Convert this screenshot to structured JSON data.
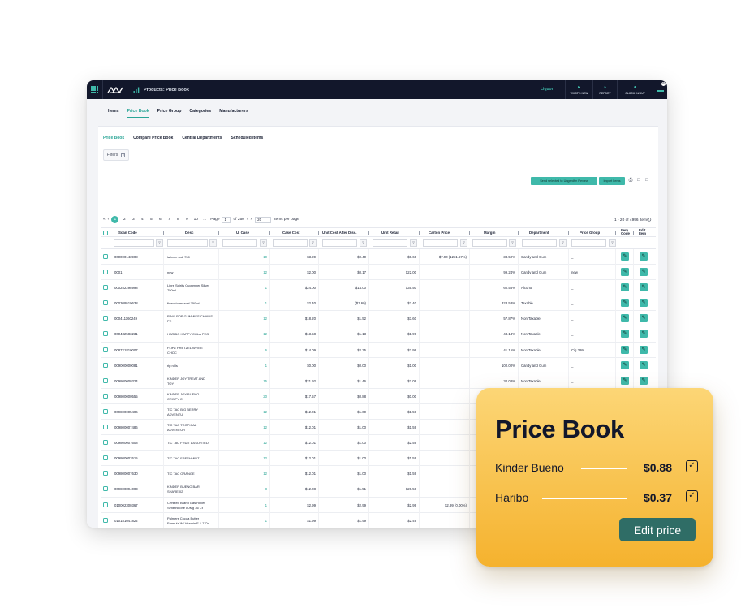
{
  "topbar": {
    "title": "Products: Price Book",
    "user": "Liquor",
    "actions": [
      {
        "label": "WHAT'S NEW",
        "icon": "megaphone-icon"
      },
      {
        "label": "REPORT",
        "icon": "report-chart-icon"
      },
      {
        "label": "CLOCK IN/OUT",
        "icon": "clock-icon"
      }
    ],
    "notification_count": "0"
  },
  "main_tabs": [
    "Items",
    "Price Book",
    "Price Group",
    "Categories",
    "Manufacturers"
  ],
  "active_main_tab": "Price Book",
  "sub_tabs": [
    "Price Book",
    "Compare Price Book",
    "Central Departments",
    "Scheduled Items"
  ],
  "filters_label": "Filters",
  "actions": {
    "send_selected": "Send selected to Ungerdfm Review",
    "import": "Import Items"
  },
  "pager": {
    "pages": [
      "1",
      "2",
      "3",
      "4",
      "5",
      "6",
      "7",
      "8",
      "9",
      "10",
      "..."
    ],
    "page_label": "Page",
    "page_value": "1",
    "of_label": "of 250",
    "per_page_value": "20",
    "per_page_label": "items per page",
    "count": "1 - 20 of 4996 items"
  },
  "columns": [
    "Scan Code",
    "Desc",
    "U. Case",
    "Case Cost",
    "Unit Cost After Disc.",
    "Unit Retail",
    "Carton Price",
    "Margin",
    "Department",
    "Price Group",
    "Item Code",
    "Edit Item"
  ],
  "rows": [
    {
      "scan": "000000143908",
      "desc": [
        "la terre cab 750"
      ],
      "ucase": "10",
      "case_cost": "$3.99",
      "unit_cost": "$0.40",
      "retail": "$0.60",
      "carton": "$7.90 (1231.67%)",
      "margin": "33.50%",
      "dept": "Candy and Gum",
      "group": "_"
    },
    {
      "scan": "0001",
      "desc": [
        "new"
      ],
      "ucase": "12",
      "case_cost": "$2.00",
      "unit_cost": "$0.17",
      "retail": "$22.00",
      "carton": "",
      "margin": "99.24%",
      "dept": "Candy and Gum",
      "group": "new"
    },
    {
      "scan": "000252298998",
      "desc": [
        "Libre Spirits Cucumber Silver",
        "750ml"
      ],
      "ucase": "1",
      "case_cost": "$24.00",
      "unit_cost": "$14.00",
      "retail": "$35.50",
      "carton": "",
      "margin": "60.56%",
      "dept": "Alcohol",
      "group": "_"
    },
    {
      "scan": "000309519638",
      "desc": [
        "fidencio mezcal 750ml"
      ],
      "ucase": "1",
      "case_cost": "$2.40",
      "unit_cost": "($7.60)",
      "retail": "$3.40",
      "carton": "",
      "margin": "323.53%",
      "dept": "Taxable",
      "group": "_"
    },
    {
      "scan": "000411160249",
      "desc": [
        "RING POP GUMMIES CHAINS",
        "PE"
      ],
      "ucase": "12",
      "case_cost": "$18.20",
      "unit_cost": "$1.52",
      "retail": "$3.60",
      "carton": "",
      "margin": "57.87%",
      "dept": "Non Taxable",
      "group": "_"
    },
    {
      "scan": "000432583231",
      "desc": [
        "HARIBO HAPPY COLA PEG"
      ],
      "ucase": "12",
      "case_cost": "$13.58",
      "unit_cost": "$1.13",
      "retail": "$1.99",
      "carton": "",
      "margin": "43.14%",
      "dept": "Non Taxable",
      "group": "_"
    },
    {
      "scan": "008721810007",
      "desc": [
        "FLIPZ PRETZEL WHITE",
        "CHOC"
      ],
      "ucase": "6",
      "case_cost": "$14.09",
      "unit_cost": "$2.35",
      "retail": "$3.99",
      "carton": "",
      "margin": "41.15%",
      "dept": "Non Taxable",
      "group": "Cig 399"
    },
    {
      "scan": "009000000081",
      "desc": [
        "rip rolls"
      ],
      "ucase": "1",
      "case_cost": "$0.00",
      "unit_cost": "$0.00",
      "retail": "$1.00",
      "carton": "",
      "margin": "100.00%",
      "dept": "Candy and Gum",
      "group": "_"
    },
    {
      "scan": "009800000324",
      "desc": [
        "KINDER JOY TREAT AND",
        "TOY"
      ],
      "ucase": "15",
      "case_cost": "$21.92",
      "unit_cost": "$1.46",
      "retail": "$2.09",
      "carton": "",
      "margin": "30.08%",
      "dept": "Non Taxable",
      "group": "_"
    },
    {
      "scan": "009800000555",
      "desc": [
        "KINDER JOY BUENO",
        "CRISPY C"
      ],
      "ucase": "20",
      "case_cost": "$17.57",
      "unit_cost": "$0.88",
      "retail": "$0.00",
      "carton": "",
      "margin": "0.00%",
      "dept": "Non Taxable",
      "group": "_"
    },
    {
      "scan": "009800005406",
      "desc": [
        "TIC TAC BIG BERRY",
        "ADVENTU"
      ],
      "ucase": "12",
      "case_cost": "$12.01",
      "unit_cost": "$1.00",
      "retail": "$1.59",
      "carton": "",
      "margin": "37.05%",
      "dept": "Non Taxable",
      "group": "_"
    },
    {
      "scan": "009800007486",
      "desc": [
        "TIC TAC TROPICAL",
        "ADVENTUR"
      ],
      "ucase": "12",
      "case_cost": "$12.01",
      "unit_cost": "$1.00",
      "retail": "$1.59",
      "carton": "",
      "margin": "37.05%",
      "dept": "Non Taxable",
      "group": "_"
    },
    {
      "scan": "009800007608",
      "desc": [
        "TIC TAC FRUIT ASSORTED"
      ],
      "ucase": "12",
      "case_cost": "$12.01",
      "unit_cost": "$1.00",
      "retail": "$2.59",
      "carton": "",
      "margin": "",
      "dept": "",
      "group": ""
    },
    {
      "scan": "009800007615",
      "desc": [
        "TIC TAC FRESHMINT"
      ],
      "ucase": "12",
      "case_cost": "$12.01",
      "unit_cost": "$1.00",
      "retail": "$1.59",
      "carton": "",
      "margin": "",
      "dept": "",
      "group": ""
    },
    {
      "scan": "009800007630",
      "desc": [
        "TIC TAC ORANGE"
      ],
      "ucase": "12",
      "case_cost": "$12.01",
      "unit_cost": "$1.00",
      "retail": "$1.59",
      "carton": "",
      "margin": "",
      "dept": "",
      "group": ""
    },
    {
      "scan": "009800894003",
      "desc": [
        "KINDER BUENO BAR",
        "SHARE 02"
      ],
      "ucase": "8",
      "case_cost": "$12.08",
      "unit_cost": "$1.51",
      "retail": "$20.50",
      "carton": "",
      "margin": "",
      "dept": "",
      "group": ""
    },
    {
      "scan": "010002300367",
      "desc": [
        "Certified Brand Gas Relief",
        "Simethicone 80Mg 36 Ct"
      ],
      "ucase": "1",
      "case_cost": "$2.99",
      "unit_cost": "$2.99",
      "retail": "$2.99",
      "carton": "$2.99 (0.00%)",
      "margin": "",
      "dept": "",
      "group": ""
    },
    {
      "scan": "010181041822",
      "desc": [
        "Palmers Cocoa Butter",
        "Formula W/ Vitamin E 1.7 Oz"
      ],
      "ucase": "1",
      "case_cost": "$1.99",
      "unit_cost": "$1.99",
      "retail": "$2.49",
      "carton": "",
      "margin": "",
      "dept": "",
      "group": ""
    },
    {
      "scan": "010228304244",
      "desc": [
        "Clorox Home Value Spray",
        "Disinfectant Country Rain",
        "Scent 6 Oz"
      ],
      "ucase": "1",
      "case_cost": "$1.99",
      "unit_cost": "$1.99",
      "retail": "$20.50",
      "carton": "",
      "margin": "",
      "dept": "",
      "group": ""
    },
    {
      "scan": "010700000071",
      "desc": [
        "Jolly Rancher Watermelon",
        "Lollipops"
      ],
      "ucase": "1",
      "case_cost": "$0.59",
      "unit_cost": "$0.59",
      "retail": "$20.50",
      "carton": "",
      "margin": "",
      "dept": "",
      "group": ""
    }
  ],
  "card": {
    "title": "Price Book",
    "items": [
      {
        "name": "Kinder Bueno",
        "price": "$0.88",
        "checked": true
      },
      {
        "name": "Haribo",
        "price": "$0.37",
        "checked": true
      }
    ],
    "button": "Edit price"
  }
}
